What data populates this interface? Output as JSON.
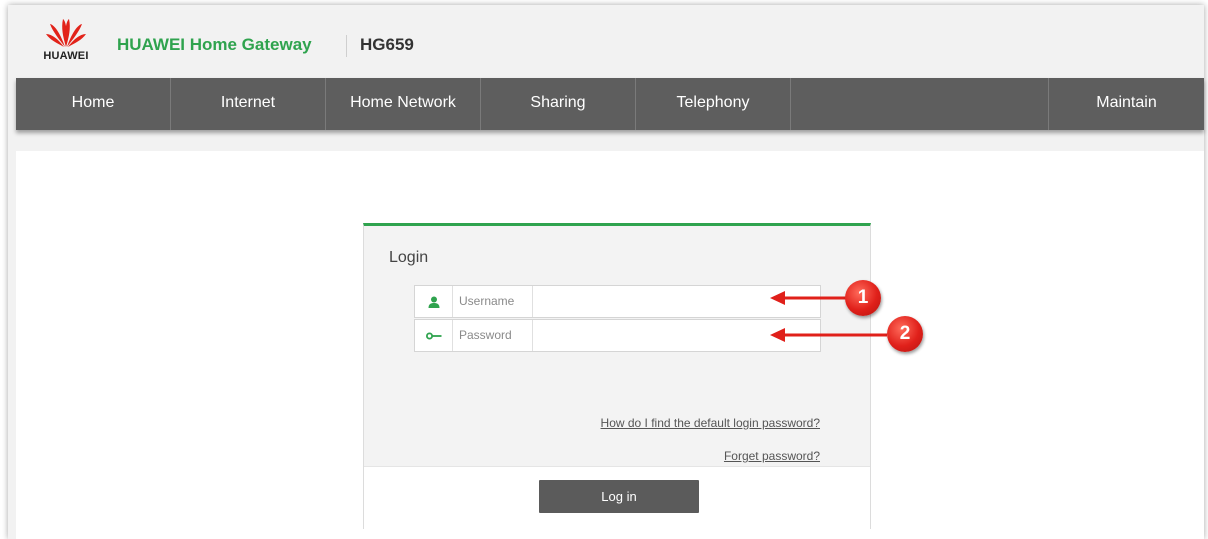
{
  "header": {
    "logo_text": "HUAWEI",
    "product_name": "HUAWEI Home Gateway",
    "model": "HG659"
  },
  "nav": {
    "items": [
      {
        "label": "Home"
      },
      {
        "label": "Internet"
      },
      {
        "label": "Home Network"
      },
      {
        "label": "Sharing"
      },
      {
        "label": "Telephony"
      },
      {
        "label": ""
      },
      {
        "label": "Maintain"
      }
    ]
  },
  "login": {
    "title": "Login",
    "username_label": "Username",
    "password_label": "Password",
    "username_value": "",
    "password_value": "",
    "default_password_link": "How do I find the default login password?",
    "forget_password_link": "Forget password?",
    "login_button": "Log in"
  },
  "annotations": {
    "marker_1": "1",
    "marker_2": "2"
  },
  "icons": {
    "logo": "huawei-logo-icon",
    "username": "user-icon",
    "password": "key-icon",
    "arrow": "red-arrow-icon"
  },
  "colors": {
    "brand_green": "#2fa34e",
    "nav_bg": "#5e5e5e",
    "annotation_red": "#e0201a"
  }
}
